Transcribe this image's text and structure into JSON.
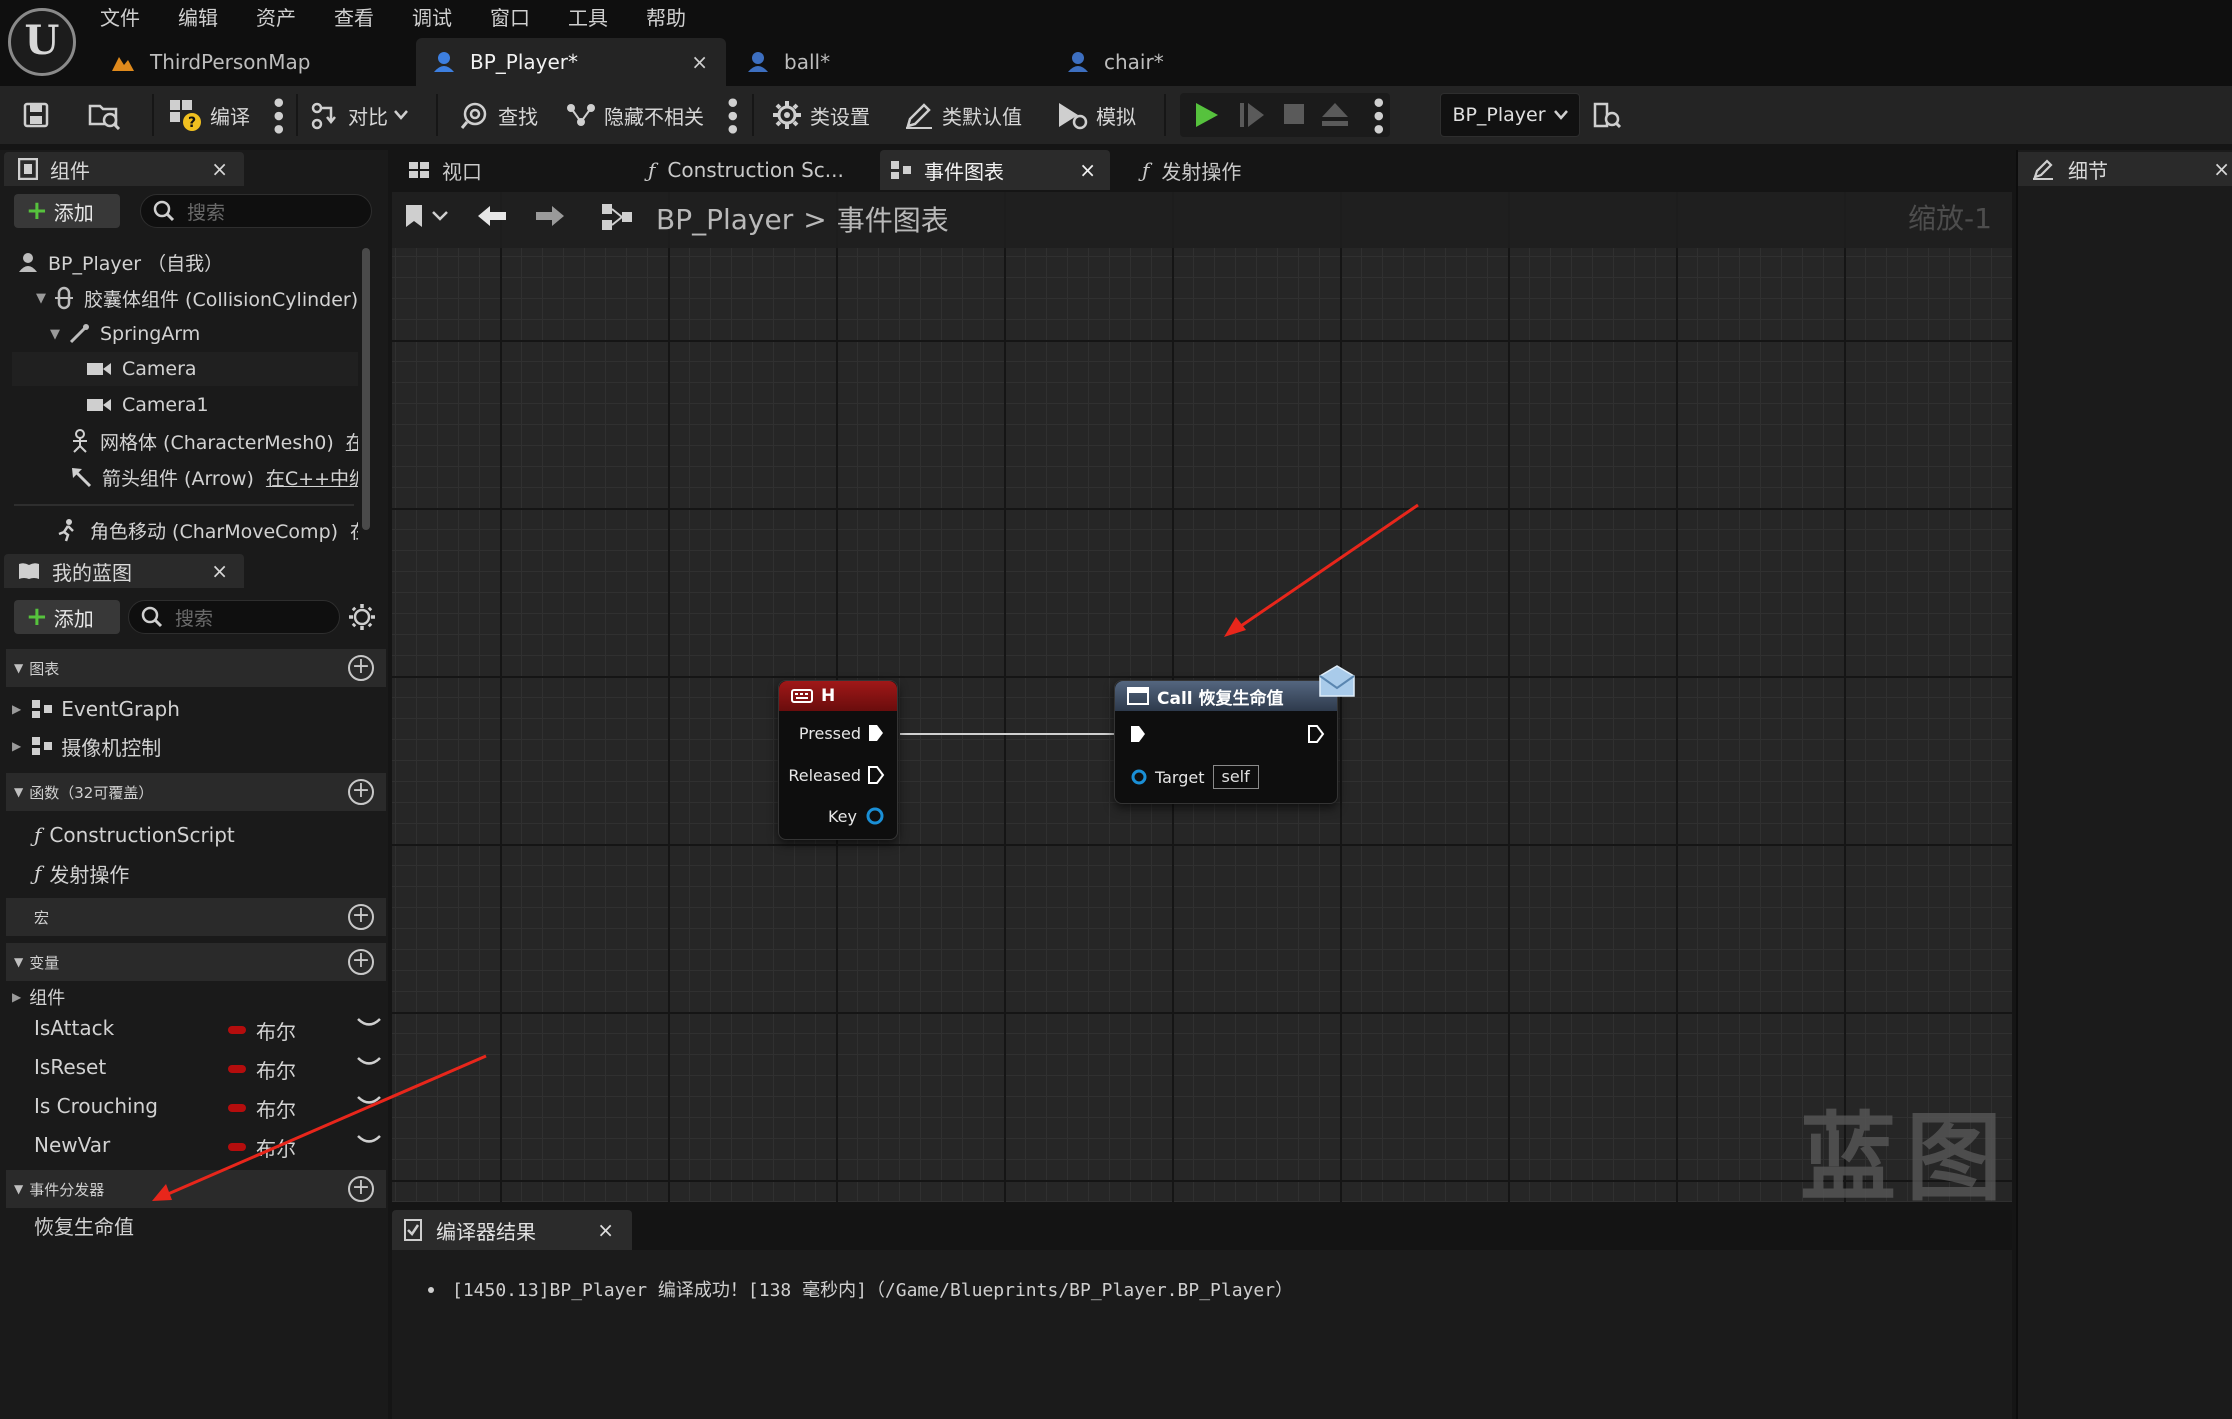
{
  "menu": [
    "文件",
    "编辑",
    "资产",
    "查看",
    "调试",
    "窗口",
    "工具",
    "帮助"
  ],
  "logo": "U",
  "doc_tabs": [
    {
      "label": "ThirdPersonMap"
    },
    {
      "label": "BP_Player*",
      "close": "×"
    },
    {
      "label": "ball*"
    },
    {
      "label": "chair*"
    }
  ],
  "toolbar": {
    "compile": "编译",
    "diff": "对比",
    "find": "查找",
    "hide_unrelated": "隐藏不相关",
    "class_settings": "类设置",
    "class_defaults": "类默认值",
    "simulate": "模拟",
    "debug_object": "BP_Player"
  },
  "components_panel": {
    "title": "组件",
    "close": "×",
    "add": "添加",
    "search_placeholder": "搜索",
    "items": [
      {
        "label": "BP_Player （自我）"
      },
      {
        "label": "胶囊体组件 (CollisionCylinder)"
      },
      {
        "label": "SpringArm"
      },
      {
        "label": "Camera"
      },
      {
        "label": "Camera1"
      },
      {
        "label": "网格体 (CharacterMesh0)",
        "extra": "在"
      },
      {
        "label": "箭头组件 (Arrow)",
        "extra": "在C++中编"
      },
      {
        "label": "角色移动 (CharMoveComp)",
        "extra": "在"
      }
    ]
  },
  "my_blueprint": {
    "title": "我的蓝图",
    "close": "×",
    "add": "添加",
    "search_placeholder": "搜索",
    "graphs_label": "图表",
    "graphs": [
      "EventGraph",
      "摄像机控制"
    ],
    "functions_label": "函数（32可覆盖）",
    "functions": [
      "ConstructionScript",
      "发射操作"
    ],
    "macros_label": "宏",
    "variables_label": "变量",
    "var_group": "组件",
    "variables": [
      {
        "name": "IsAttack",
        "type": "布尔"
      },
      {
        "name": "IsReset",
        "type": "布尔"
      },
      {
        "name": "Is Crouching",
        "type": "布尔"
      },
      {
        "name": "NewVar",
        "type": "布尔"
      }
    ],
    "dispatchers_label": "事件分发器",
    "dispatchers": [
      "恢复生命值"
    ]
  },
  "editor_tabs": [
    {
      "label": "视口"
    },
    {
      "label": "Construction Sc..."
    },
    {
      "label": "事件图表",
      "close": "×"
    },
    {
      "label": "发射操作"
    }
  ],
  "graph": {
    "breadcrumb_root": "BP_Player",
    "breadcrumb_sep": ">",
    "breadcrumb_current": "事件图表",
    "zoom": "缩放-1",
    "watermark": "蓝图",
    "key_node": {
      "title": "H",
      "pins": [
        "Pressed",
        "Released",
        "Key"
      ]
    },
    "call_node": {
      "title": "Call 恢复生命值",
      "target_label": "Target",
      "target_value": "self"
    }
  },
  "compiler": {
    "title": "编译器结果",
    "close": "×",
    "message": "[1450.13]BP_Player 编译成功！[138 毫秒内]（/Game/Blueprints/BP_Player.BP_Player）"
  },
  "details": {
    "title": "细节",
    "close": "×"
  },
  "colors": {
    "annotation_arrow": "#e8261b",
    "key_node_header": "#8c1212",
    "call_node_header": "#3c4c63",
    "play_green": "#56c23d",
    "bool_pin": "#b50d0d",
    "object_pin": "#1a8fd6"
  }
}
